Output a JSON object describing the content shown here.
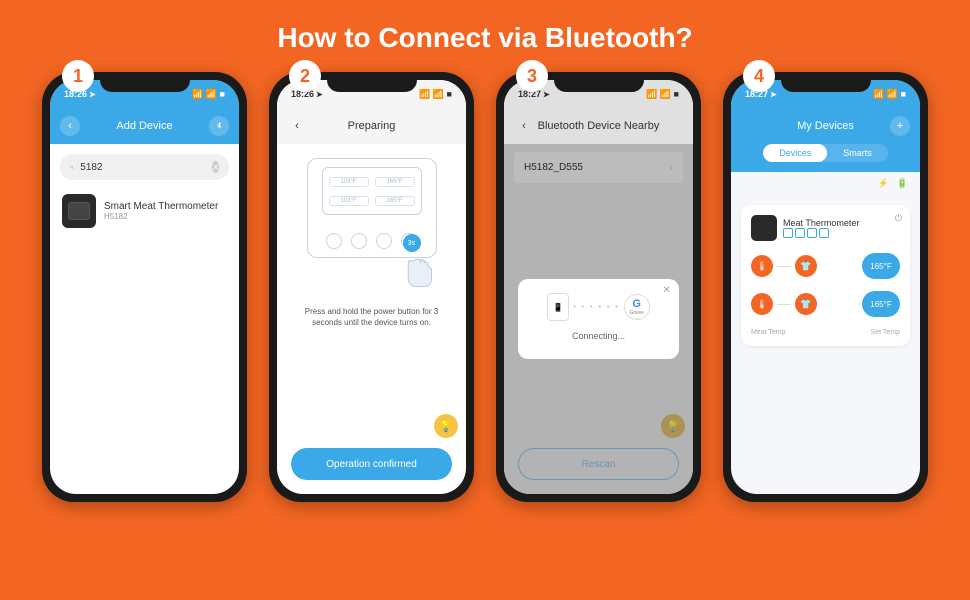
{
  "title": "How to Connect via Bluetooth?",
  "steps": [
    "1",
    "2",
    "3",
    "4"
  ],
  "time1": "18:26",
  "time2": "18:27",
  "screen1": {
    "header": "Add Device",
    "search_value": "5182",
    "device_name": "Smart Meat Thermometer",
    "device_model": "H5182"
  },
  "screen2": {
    "header": "Preparing",
    "temps": [
      "103°F",
      "165°F",
      "103°F",
      "165°F"
    ],
    "hold_badge": "3s",
    "instruction": "Press and hold the power button for 3 seconds until the device turns on.",
    "button": "Operation confirmed"
  },
  "screen3": {
    "header": "Bluetooth Device Nearby",
    "device_id": "H5182_D555",
    "brand": "Govee",
    "status": "Connecting...",
    "rescan": "Rescan"
  },
  "screen4": {
    "header": "My Devices",
    "tab1": "Devices",
    "tab2": "Smarts",
    "card_title": "Meat Thermometer",
    "set_temp": "165°F",
    "label_left": "Meat Temp",
    "label_right": "Set Temp"
  }
}
